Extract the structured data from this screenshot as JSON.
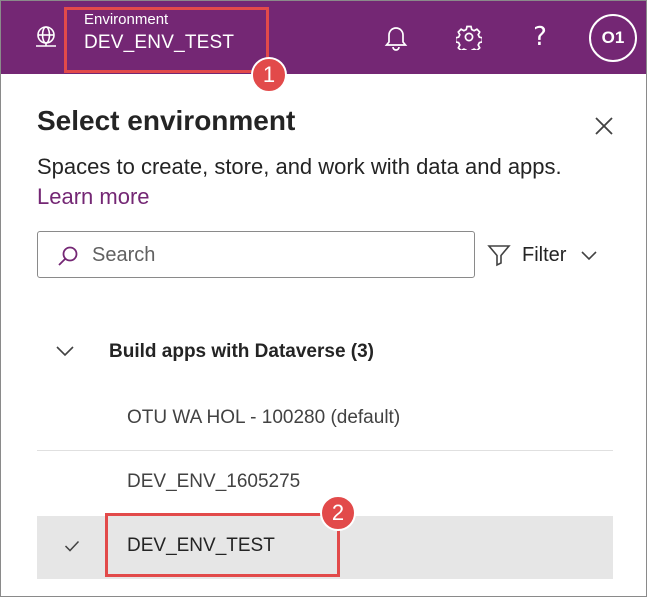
{
  "header": {
    "environment_label": "Environment",
    "environment_name": "DEV_ENV_TEST",
    "avatar_initials": "O1",
    "help_glyph": "?",
    "bar_color": "#742774",
    "icons": [
      "globe-icon",
      "bell-icon",
      "gear-icon",
      "help-icon"
    ]
  },
  "annotations": {
    "callout_1": "1",
    "callout_2": "2",
    "color": "#e24a4a"
  },
  "panel": {
    "title": "Select environment",
    "description": "Spaces to create, store, and work with data and apps.",
    "learn_more": "Learn more",
    "search_placeholder": "Search",
    "filter_label": "Filter"
  },
  "group": {
    "label": "Build apps with Dataverse (3)",
    "items": [
      {
        "label": "OTU WA HOL - 100280 (default)",
        "selected": false
      },
      {
        "label": "DEV_ENV_1605275",
        "selected": false
      },
      {
        "label": "DEV_ENV_TEST",
        "selected": true
      }
    ]
  }
}
